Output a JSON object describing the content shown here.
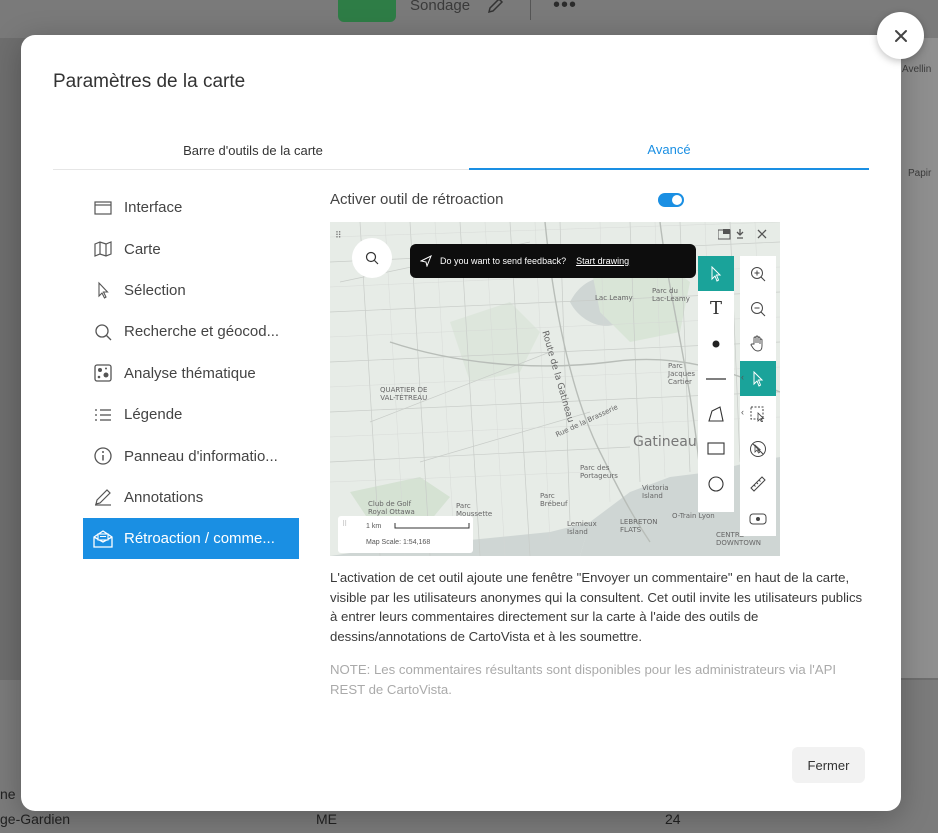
{
  "background": {
    "project_name": "Sondage",
    "map_labels": [
      "Avellin",
      "Papir"
    ],
    "row_cells": [
      "ge-Gardien",
      "ME",
      "24"
    ],
    "row_prev": "ne"
  },
  "modal": {
    "title": "Paramètres de la carte",
    "close_label": "×",
    "tabs": [
      {
        "label": "Barre d'outils de la carte",
        "active": false
      },
      {
        "label": "Avancé",
        "active": true
      }
    ],
    "sidebar": [
      {
        "label": "Interface",
        "icon": "window-icon"
      },
      {
        "label": "Carte",
        "icon": "map-icon"
      },
      {
        "label": "Sélection",
        "icon": "cursor-icon"
      },
      {
        "label": "Recherche et géocod...",
        "icon": "search-icon"
      },
      {
        "label": "Analyse thématique",
        "icon": "thematic-icon"
      },
      {
        "label": "Légende",
        "icon": "list-icon"
      },
      {
        "label": "Panneau d'informatio...",
        "icon": "info-icon"
      },
      {
        "label": "Annotations",
        "icon": "pen-icon"
      },
      {
        "label": "Rétroaction / comme...",
        "icon": "feedback-mail-icon",
        "active": true
      }
    ],
    "feedback": {
      "toggle_label": "Activer outil de rétroaction",
      "toggle_on": true,
      "description": "L'activation de cet outil ajoute une fenêtre \"Envoyer un commentaire\" en haut de la carte, visible par les utilisateurs anonymes qui la consultent. Cet outil invite les utilisateurs publics à entrer leurs commentaires directement sur la carte à l'aide des outils de dessins/annotations de CartoVista et à les soumettre.",
      "note": "NOTE: Les commentaires résultants sont disponibles pour les administrateurs via l'API REST de CartoVista."
    },
    "preview": {
      "banner_text": "Do you want to send feedback?",
      "banner_link": "Start drawing",
      "scale_distance": "1 km",
      "scale_text": "Map Scale: 1:54,168",
      "labels": {
        "lac_leamy": "Lac Leamy",
        "parc_lac_leamy": "Parc du\nLac-Leamy",
        "route_gatineau": "Route de la Gatineau",
        "quartier": "QUARTIER DE\nVAL-TÉTREAU",
        "rue_brasserie": "Rue de la Brasserie",
        "gatineau": "Gatineau",
        "parc_jacques": "Parc\nJacques\nCartier",
        "parc_portageurs": "Parc des\nPortageurs",
        "club_golf": "Club de Golf\nRoyal Ottawa",
        "parc_moussette": "Parc\nMoussette",
        "parc_brebeuf": "Parc\nBrébeuf",
        "victoria": "Victoria\nIsland",
        "lemieux": "Lemieux\nIsland",
        "lebreton": "LEBRETON\nFLATS",
        "otrain": "O-Train Lyon",
        "centre": "CENTRE-\nDOWNTOWN"
      },
      "draw_tools": [
        "pointer-tool-icon",
        "text-tool-icon",
        "point-tool-icon",
        "line-tool-icon",
        "polygon-tool-icon",
        "rectangle-tool-icon",
        "circle-tool-icon"
      ],
      "map_tools": [
        "zoom-in-icon",
        "zoom-out-icon",
        "pan-hand-icon",
        "select-arrow-icon",
        "box-select-icon",
        "clear-selection-icon",
        "measure-ruler-icon",
        "locate-icon"
      ]
    },
    "close_button": "Fermer"
  },
  "colors": {
    "accent": "#1a8fe3",
    "tool_active": "#1aa39a",
    "overlay": "#6e6e6e"
  }
}
